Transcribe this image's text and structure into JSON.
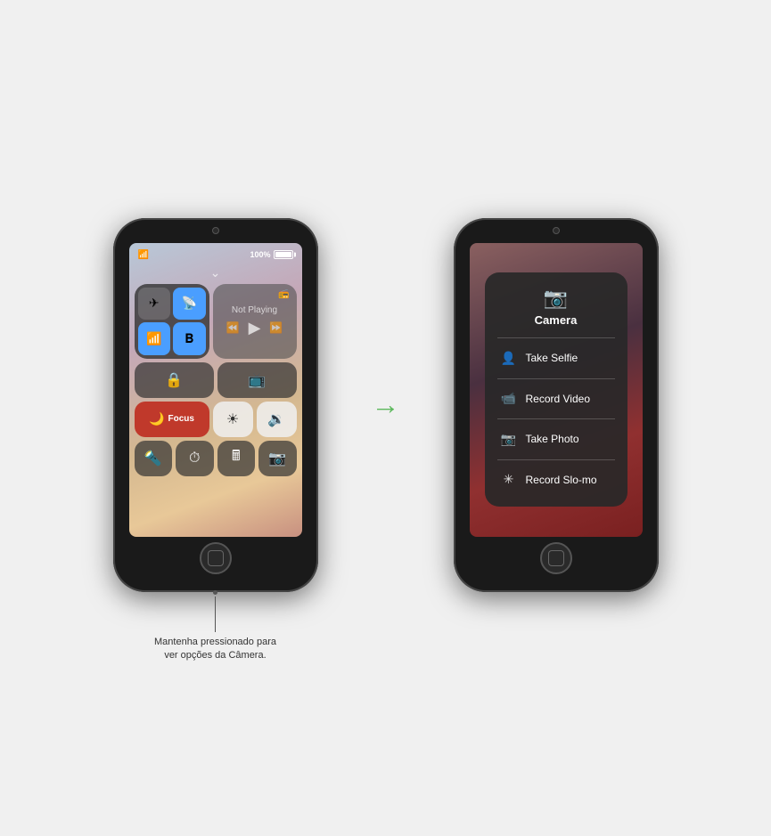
{
  "left_device": {
    "status": {
      "battery_pct": "100%"
    },
    "now_playing": {
      "title": "Not Playing"
    },
    "focus": {
      "label": "Focus"
    },
    "controls": {
      "airplane_icon": "✈",
      "hotspot_icon": "📡",
      "wifi_icon": "📶",
      "bluetooth_icon": "🔵",
      "rotation_icon": "🔒",
      "screen_mirror_icon": "📺",
      "focus_moon_icon": "🌙",
      "brightness_icon": "☀",
      "volume_icon": "🔊",
      "flashlight_icon": "🔦",
      "timer_icon": "⏱",
      "calculator_icon": "🔢",
      "camera_icon": "📷"
    }
  },
  "right_device": {
    "camera_menu": {
      "title": "Camera",
      "items": [
        {
          "label": "Take Selfie",
          "icon": "👤"
        },
        {
          "label": "Record Video",
          "icon": "🎥"
        },
        {
          "label": "Take Photo",
          "icon": "📷"
        },
        {
          "label": "Record Slo-mo",
          "icon": "✳"
        }
      ]
    }
  },
  "callout": {
    "text": "Mantenha pressionado para\nver opções da Câmera."
  },
  "arrow": "→"
}
